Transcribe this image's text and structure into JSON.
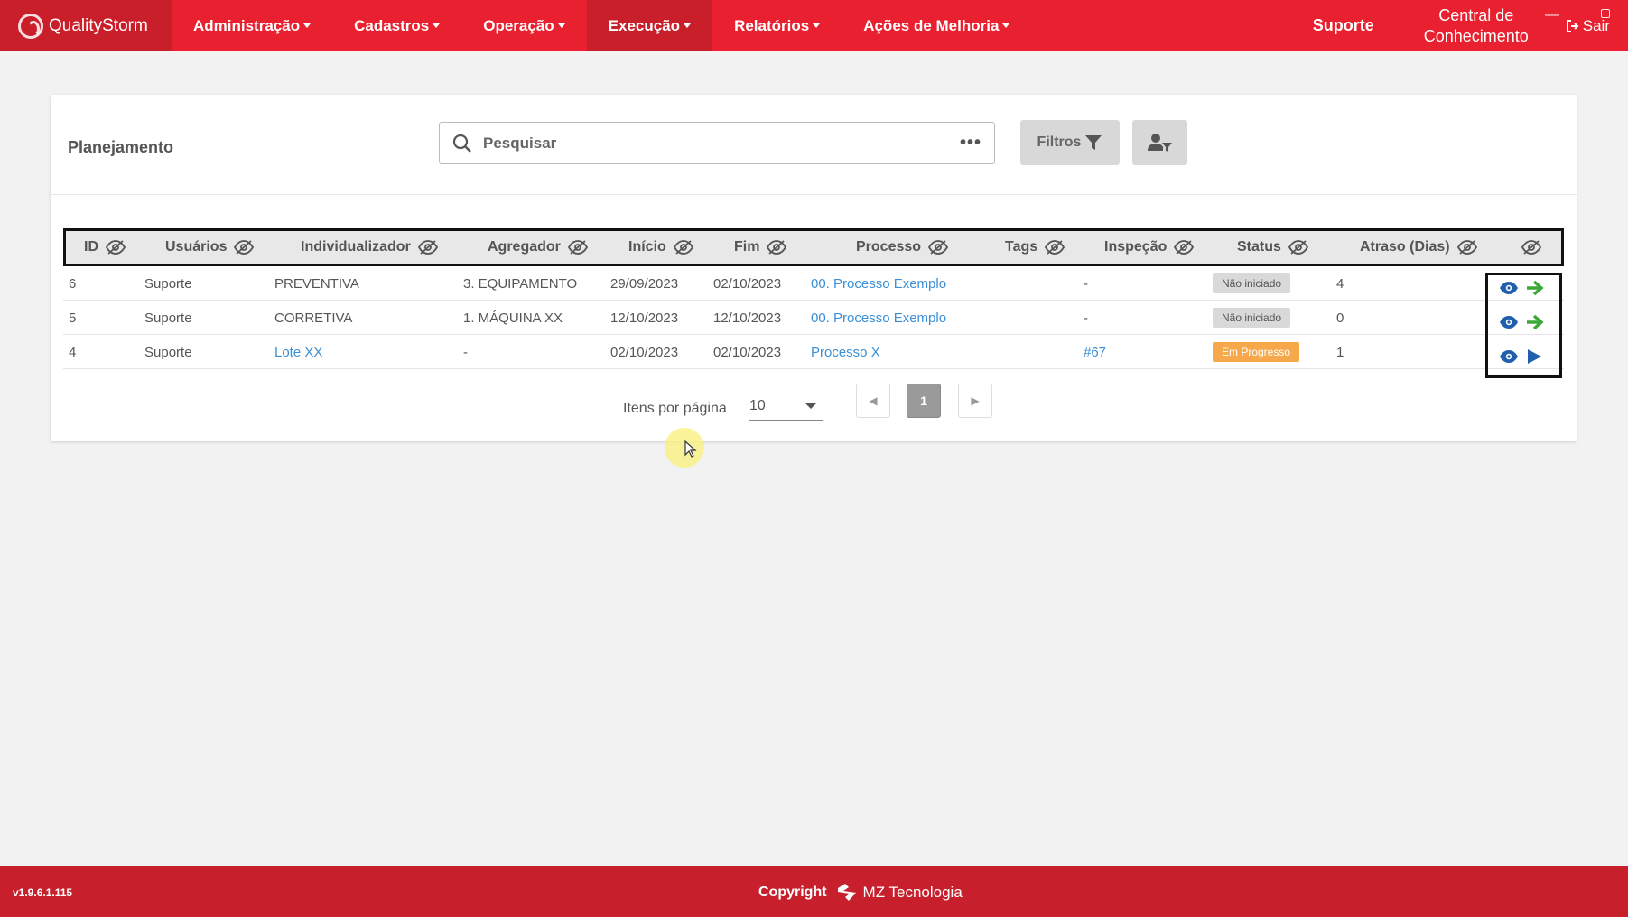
{
  "navbar": {
    "brand": "QualityStorm",
    "menu": [
      {
        "label": "Administração"
      },
      {
        "label": "Cadastros"
      },
      {
        "label": "Operação"
      },
      {
        "label": "Execução"
      },
      {
        "label": "Relatórios"
      },
      {
        "label": "Ações de Melhoria"
      }
    ],
    "support": "Suporte",
    "central_line1": "Central de",
    "central_line2": "Conhecimento",
    "exit": "Sair"
  },
  "page": {
    "title": "Planejamento",
    "search_placeholder": "Pesquisar",
    "filter_label": "Filtros"
  },
  "table": {
    "columns": [
      "ID",
      "Usuários",
      "Individualizador",
      "Agregador",
      "Início",
      "Fim",
      "Processo",
      "Tags",
      "Inspeção",
      "Status",
      "Atraso (Dias)"
    ],
    "rows": [
      {
        "id": "6",
        "usuarios": "Suporte",
        "individualizador": "PREVENTIVA",
        "agregador": "3. EQUIPAMENTO",
        "inicio": "29/09/2023",
        "fim": "02/10/2023",
        "processo": "00. Processo Exemplo",
        "tags": "",
        "inspecao": "-",
        "status": "Não iniciado",
        "atraso": "4"
      },
      {
        "id": "5",
        "usuarios": "Suporte",
        "individualizador": "CORRETIVA",
        "agregador": "1. MÁQUINA XX",
        "inicio": "12/10/2023",
        "fim": "12/10/2023",
        "processo": "00. Processo Exemplo",
        "tags": "",
        "inspecao": "-",
        "status": "Não iniciado",
        "atraso": "0"
      },
      {
        "id": "4",
        "usuarios": "Suporte",
        "individualizador": "Lote XX",
        "agregador": "-",
        "inicio": "02/10/2023",
        "fim": "02/10/2023",
        "processo": "Processo X",
        "tags": "",
        "inspecao": "#67",
        "status": "Em Progresso",
        "atraso": "1"
      }
    ]
  },
  "pagination": {
    "per_page_label": "Itens por página",
    "per_page_value": "10",
    "current_page": "1"
  },
  "footer": {
    "version": "v1.9.6.1.115",
    "copyright": "Copyright",
    "company": "MZ Tecnologia"
  },
  "colors": {
    "navbar": "#e8202f",
    "navbar_active": "#c91f2a",
    "link": "#3a8fd6",
    "status_not_started": "#d9d9d9",
    "status_in_progress": "#f7a84a",
    "action_view": "#1f5fae",
    "action_go": "#3aa935"
  }
}
